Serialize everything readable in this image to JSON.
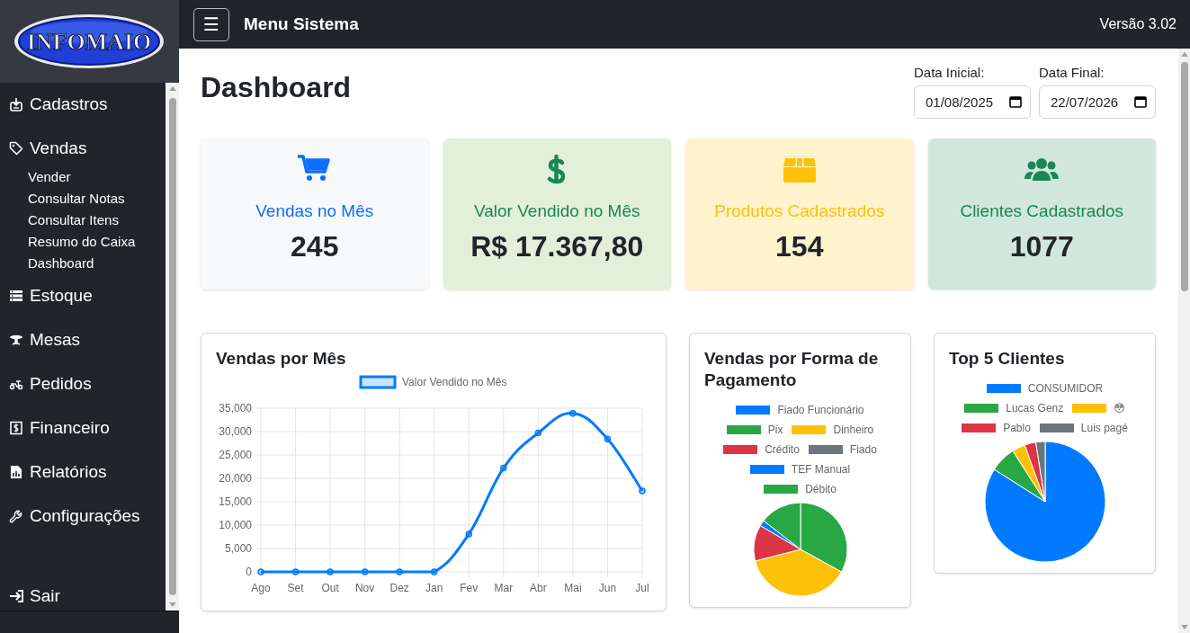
{
  "sidebar": {
    "logo": "INFOMAIO",
    "items": [
      {
        "label": "Cadastros"
      },
      {
        "label": "Vendas",
        "children": [
          {
            "label": "Vender"
          },
          {
            "label": "Consultar Notas"
          },
          {
            "label": "Consultar Itens"
          },
          {
            "label": "Resumo do Caixa"
          },
          {
            "label": "Dashboard"
          }
        ]
      },
      {
        "label": "Estoque"
      },
      {
        "label": "Mesas"
      },
      {
        "label": "Pedidos"
      },
      {
        "label": "Financeiro"
      },
      {
        "label": "Relatórios"
      },
      {
        "label": "Configurações"
      }
    ],
    "logout": "Sair"
  },
  "topbar": {
    "menu_button": "☰",
    "title": "Menu Sistema",
    "version": "Versão 3.02"
  },
  "page": {
    "title": "Dashboard",
    "date_fields": [
      {
        "label": "Data Inicial:",
        "value": "01/08/2025"
      },
      {
        "label": "Data Final:",
        "value": "22/07/2026"
      }
    ]
  },
  "stats": [
    {
      "kind": "sales",
      "label": "Vendas no Mês",
      "value": "245"
    },
    {
      "kind": "revenue",
      "label": "Valor Vendido no Mês",
      "value": "R$ 17.367,80"
    },
    {
      "kind": "products",
      "label": "Produtos Cadastrados",
      "value": "154"
    },
    {
      "kind": "clients",
      "label": "Clientes Cadastrados",
      "value": "1077"
    }
  ],
  "charts": [
    {
      "title": "Vendas por Mês",
      "chart_data": {
        "type": "line",
        "categories": [
          "Ago",
          "Set",
          "Out",
          "Nov",
          "Dez",
          "Jan",
          "Fev",
          "Mar",
          "Abr",
          "Mai",
          "Jun",
          "Jul"
        ],
        "series": [
          {
            "name": "Valor Vendido no Mês",
            "color": "#007bff",
            "marker": "circle",
            "values": [
              0,
              0,
              0,
              0,
              0,
              0,
              8100,
              22200,
              29700,
              33900,
              28400,
              17300
            ]
          }
        ],
        "grid": true,
        "ylim": [
          0,
          35000
        ],
        "yticks": [
          {
            "value": 0,
            "label": "0"
          },
          {
            "value": 5000,
            "label": "5,000"
          },
          {
            "value": 10000,
            "label": "10,000"
          },
          {
            "value": 15000,
            "label": "15,000"
          },
          {
            "value": 20000,
            "label": "20,000"
          },
          {
            "value": 25000,
            "label": "25,000"
          },
          {
            "value": 30000,
            "label": "30,000"
          },
          {
            "value": 35000,
            "label": "35,000"
          }
        ]
      }
    },
    {
      "title": "Vendas por Forma de Pagamento",
      "chart_data": {
        "type": "pie",
        "categories": [
          "Fiado Funcionário",
          "Pix",
          "Dinheiro",
          "Crédito",
          "Fiado",
          "TEF Manual",
          "Débito"
        ],
        "values": [
          0,
          33,
          38,
          12.5,
          0,
          2,
          14.5
        ],
        "colors": [
          "#007bff",
          "#28a745",
          "#ffc107",
          "#dc3545",
          "#6c757d",
          "#007bff",
          "#28a745"
        ]
      }
    },
    {
      "title": "Top 5 Clientes",
      "chart_data": {
        "type": "pie",
        "categories": [
          "CONSUMIDOR",
          "Lucas Genz",
          "😳",
          "Pablo",
          "Luis pagé"
        ],
        "values": [
          84,
          7,
          3.5,
          3,
          2.5
        ],
        "colors": [
          "#007bff",
          "#28a745",
          "#ffc107",
          "#dc3545",
          "#6c757d"
        ]
      }
    }
  ]
}
